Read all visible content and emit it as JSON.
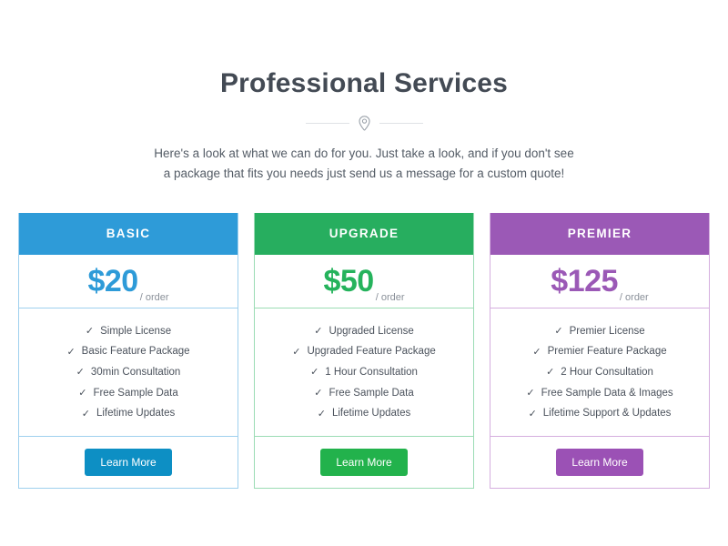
{
  "header": {
    "title": "Professional Services",
    "divider_icon": "map-pin-icon",
    "subtitle": "Here's a look at what we can do for you. Just take a look, and if you don't see a package that fits you needs just send us a message for a custom quote!"
  },
  "colors": {
    "title_text": "#434a54",
    "body_text": "#545c66",
    "page_background": "#ffffff",
    "divider_line": "#dfe2e6"
  },
  "plans": [
    {
      "name": "BASIC",
      "price": "$20",
      "price_unit": "/ order",
      "header_color": "#2e9bd8",
      "border_color": "#9fd0ee",
      "price_color": "#2e9bd8",
      "button_color": "#0d8fc4",
      "button_label": "Learn More",
      "features": [
        "Simple License",
        "Basic Feature Package",
        "30min Consultation",
        "Free Sample Data",
        "Lifetime Updates"
      ]
    },
    {
      "name": "UPGRADE",
      "price": "$50",
      "price_unit": "/ order",
      "header_color": "#27ae5f",
      "border_color": "#9bdcb4",
      "price_color": "#25b35c",
      "button_color": "#22b24c",
      "button_label": "Learn More",
      "features": [
        "Upgraded License",
        "Upgraded Feature Package",
        "1 Hour Consultation",
        "Free Sample Data",
        "Lifetime Updates"
      ]
    },
    {
      "name": "PREMIER",
      "price": "$125",
      "price_unit": "/ order",
      "header_color": "#9b59b6",
      "border_color": "#d5aedf",
      "price_color": "#9b59b6",
      "button_color": "#9b51b5",
      "button_label": "Learn More",
      "features": [
        "Premier License",
        "Premier Feature Package",
        "2 Hour Consultation",
        "Free Sample Data & Images",
        "Lifetime Support & Updates"
      ]
    }
  ],
  "check_glyph": "✓"
}
